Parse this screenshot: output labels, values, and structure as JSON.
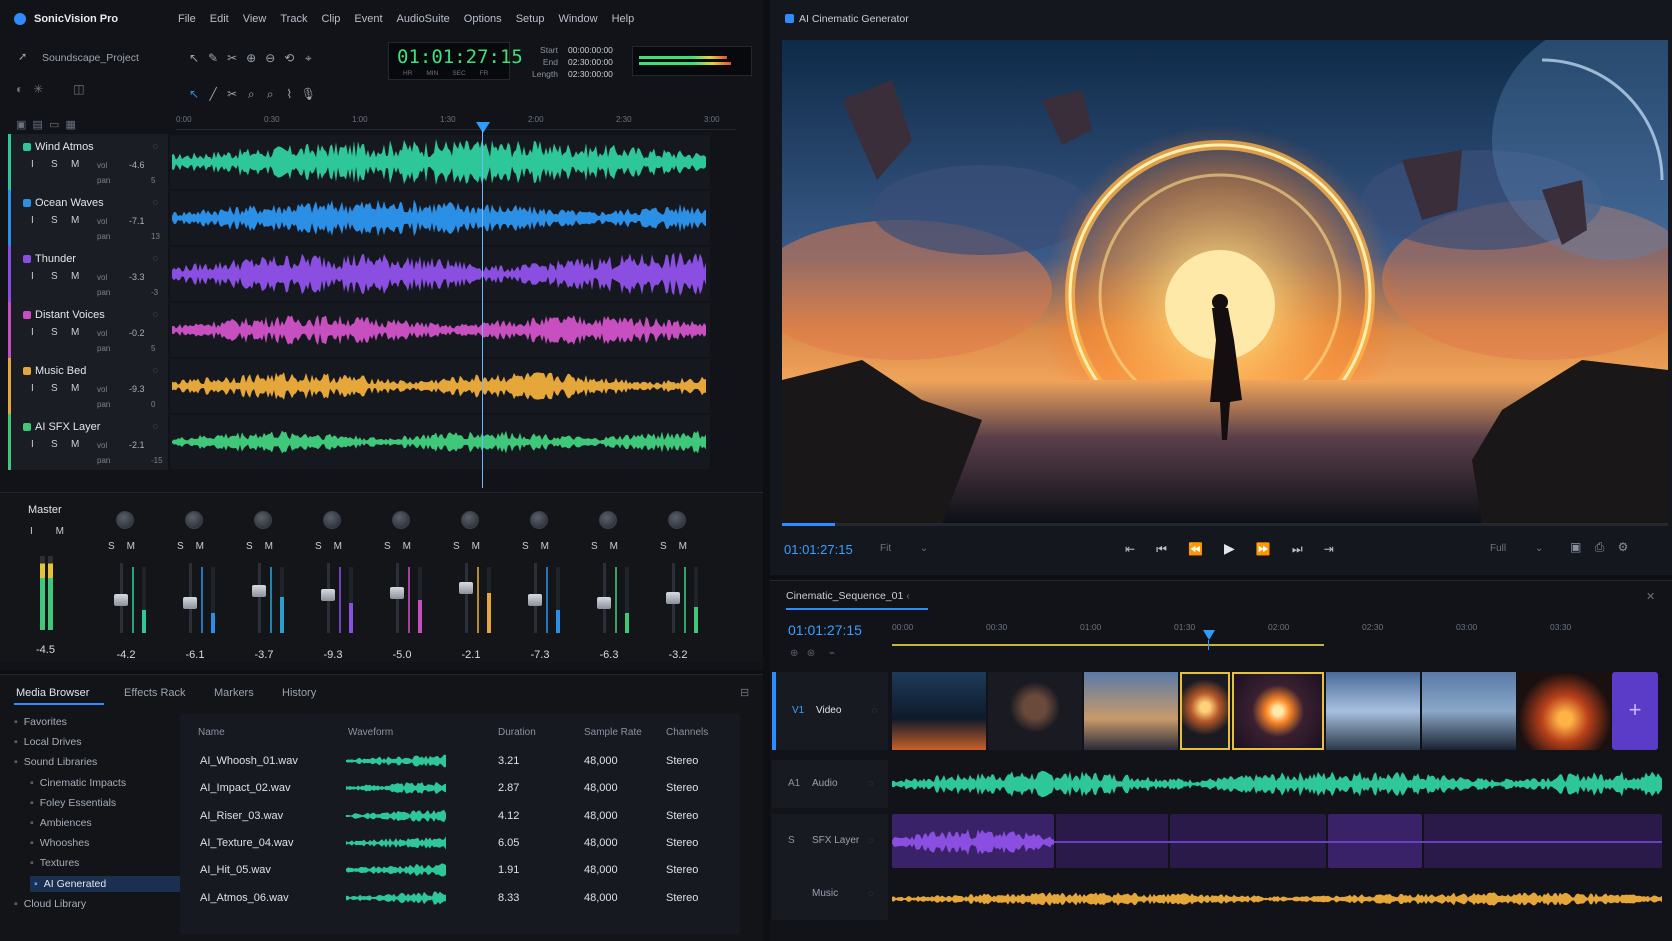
{
  "app": {
    "name": "SonicVision Pro",
    "project": "Soundscape_Project"
  },
  "menu": [
    "File",
    "Edit",
    "View",
    "Track",
    "Clip",
    "Event",
    "AudioSuite",
    "Options",
    "Setup",
    "Window",
    "Help"
  ],
  "timecode": {
    "value": "01:01:27:15",
    "units": [
      "HR",
      "MIN",
      "SEC",
      "FR"
    ]
  },
  "range": {
    "start_label": "Start",
    "start": "00:00:00:00",
    "end_label": "End",
    "end": "02:30:00:00",
    "length_label": "Length",
    "length": "02:30:00:00"
  },
  "ruler": [
    "0:00",
    "0:30",
    "1:00",
    "1:30",
    "2:00",
    "2:30",
    "3:00"
  ],
  "tracks": [
    {
      "name": "Wind Atmos",
      "vol": "-4.6",
      "pan": "5",
      "color": "#2ec79a"
    },
    {
      "name": "Ocean Waves",
      "vol": "-7.1",
      "pan": "13",
      "color": "#2c8fe6"
    },
    {
      "name": "Thunder",
      "vol": "-3.3",
      "pan": "-3",
      "color": "#8a4fe0"
    },
    {
      "name": "Distant Voices",
      "vol": "-0.2",
      "pan": "5",
      "color": "#c84fbf"
    },
    {
      "name": "Music Bed",
      "vol": "-9.3",
      "pan": "0",
      "color": "#e5a63a"
    },
    {
      "name": "AI SFX Layer",
      "vol": "-2.1",
      "pan": "-15",
      "color": "#3fc77a"
    }
  ],
  "track_buttons": [
    "I",
    "S",
    "M"
  ],
  "track_labels": {
    "vol": "vol",
    "pan": "pan"
  },
  "mixer": {
    "master_label": "Master",
    "master_db": "-4.5",
    "strips": [
      {
        "db": "-4.2",
        "color": "#2ec79a",
        "level": 0.35
      },
      {
        "db": "-6.1",
        "color": "#2c8fe6",
        "level": 0.3
      },
      {
        "db": "-3.7",
        "color": "#2a9fd0",
        "level": 0.55
      },
      {
        "db": "-9.3",
        "color": "#8a4fe0",
        "level": 0.45
      },
      {
        "db": "-5.0",
        "color": "#c84fbf",
        "level": 0.5
      },
      {
        "db": "-2.1",
        "color": "#e5a63a",
        "level": 0.6
      },
      {
        "db": "-7.3",
        "color": "#2c8fe6",
        "level": 0.35
      },
      {
        "db": "-6.3",
        "color": "#3fc77a",
        "level": 0.3
      },
      {
        "db": "-3.2",
        "color": "#3fc77a",
        "level": 0.4
      }
    ]
  },
  "media_tabs": [
    "Media Browser",
    "Effects Rack",
    "Markers",
    "History"
  ],
  "tree": [
    {
      "label": "Favorites",
      "indent": 0
    },
    {
      "label": "Local Drives",
      "indent": 0
    },
    {
      "label": "Sound Libraries",
      "indent": 0
    },
    {
      "label": "Cinematic Impacts",
      "indent": 1
    },
    {
      "label": "Foley Essentials",
      "indent": 1
    },
    {
      "label": "Ambiences",
      "indent": 1
    },
    {
      "label": "Whooshes",
      "indent": 1
    },
    {
      "label": "Textures",
      "indent": 1
    },
    {
      "label": "AI Generated",
      "indent": 1,
      "selected": true
    },
    {
      "label": "Cloud Library",
      "indent": 0
    }
  ],
  "table": {
    "headers": [
      "Name",
      "Waveform",
      "Duration",
      "Sample Rate",
      "Channels"
    ],
    "rows": [
      {
        "name": "AI_Whoosh_01.wav",
        "duration": "3.21",
        "rate": "48,000",
        "channels": "Stereo"
      },
      {
        "name": "AI_Impact_02.wav",
        "duration": "2.87",
        "rate": "48,000",
        "channels": "Stereo"
      },
      {
        "name": "AI_Riser_03.wav",
        "duration": "4.12",
        "rate": "48,000",
        "channels": "Stereo"
      },
      {
        "name": "AI_Texture_04.wav",
        "duration": "6.05",
        "rate": "48,000",
        "channels": "Stereo"
      },
      {
        "name": "AI_Hit_05.wav",
        "duration": "1.91",
        "rate": "48,000",
        "channels": "Stereo"
      },
      {
        "name": "AI_Atmos_06.wav",
        "duration": "8.33",
        "rate": "48,000",
        "channels": "Stereo"
      }
    ]
  },
  "generator": {
    "title": "AI Cinematic Generator",
    "timecode": "01:01:27:15",
    "fit": "Fit",
    "full": "Full",
    "progress": 0.06
  },
  "sequence": {
    "tab": "Cinematic_Sequence_01",
    "timecode": "01:01:27:15",
    "ruler": [
      "00:00",
      "00:30",
      "01:00",
      "01:30",
      "02:00",
      "02:30",
      "03:00",
      "03:30"
    ],
    "tracks": [
      {
        "id": "V1",
        "name": "Video"
      },
      {
        "id": "A1",
        "name": "Audio"
      },
      {
        "id": "S",
        "name": "SFX Layer"
      },
      {
        "id": "",
        "name": "Music"
      }
    ]
  }
}
